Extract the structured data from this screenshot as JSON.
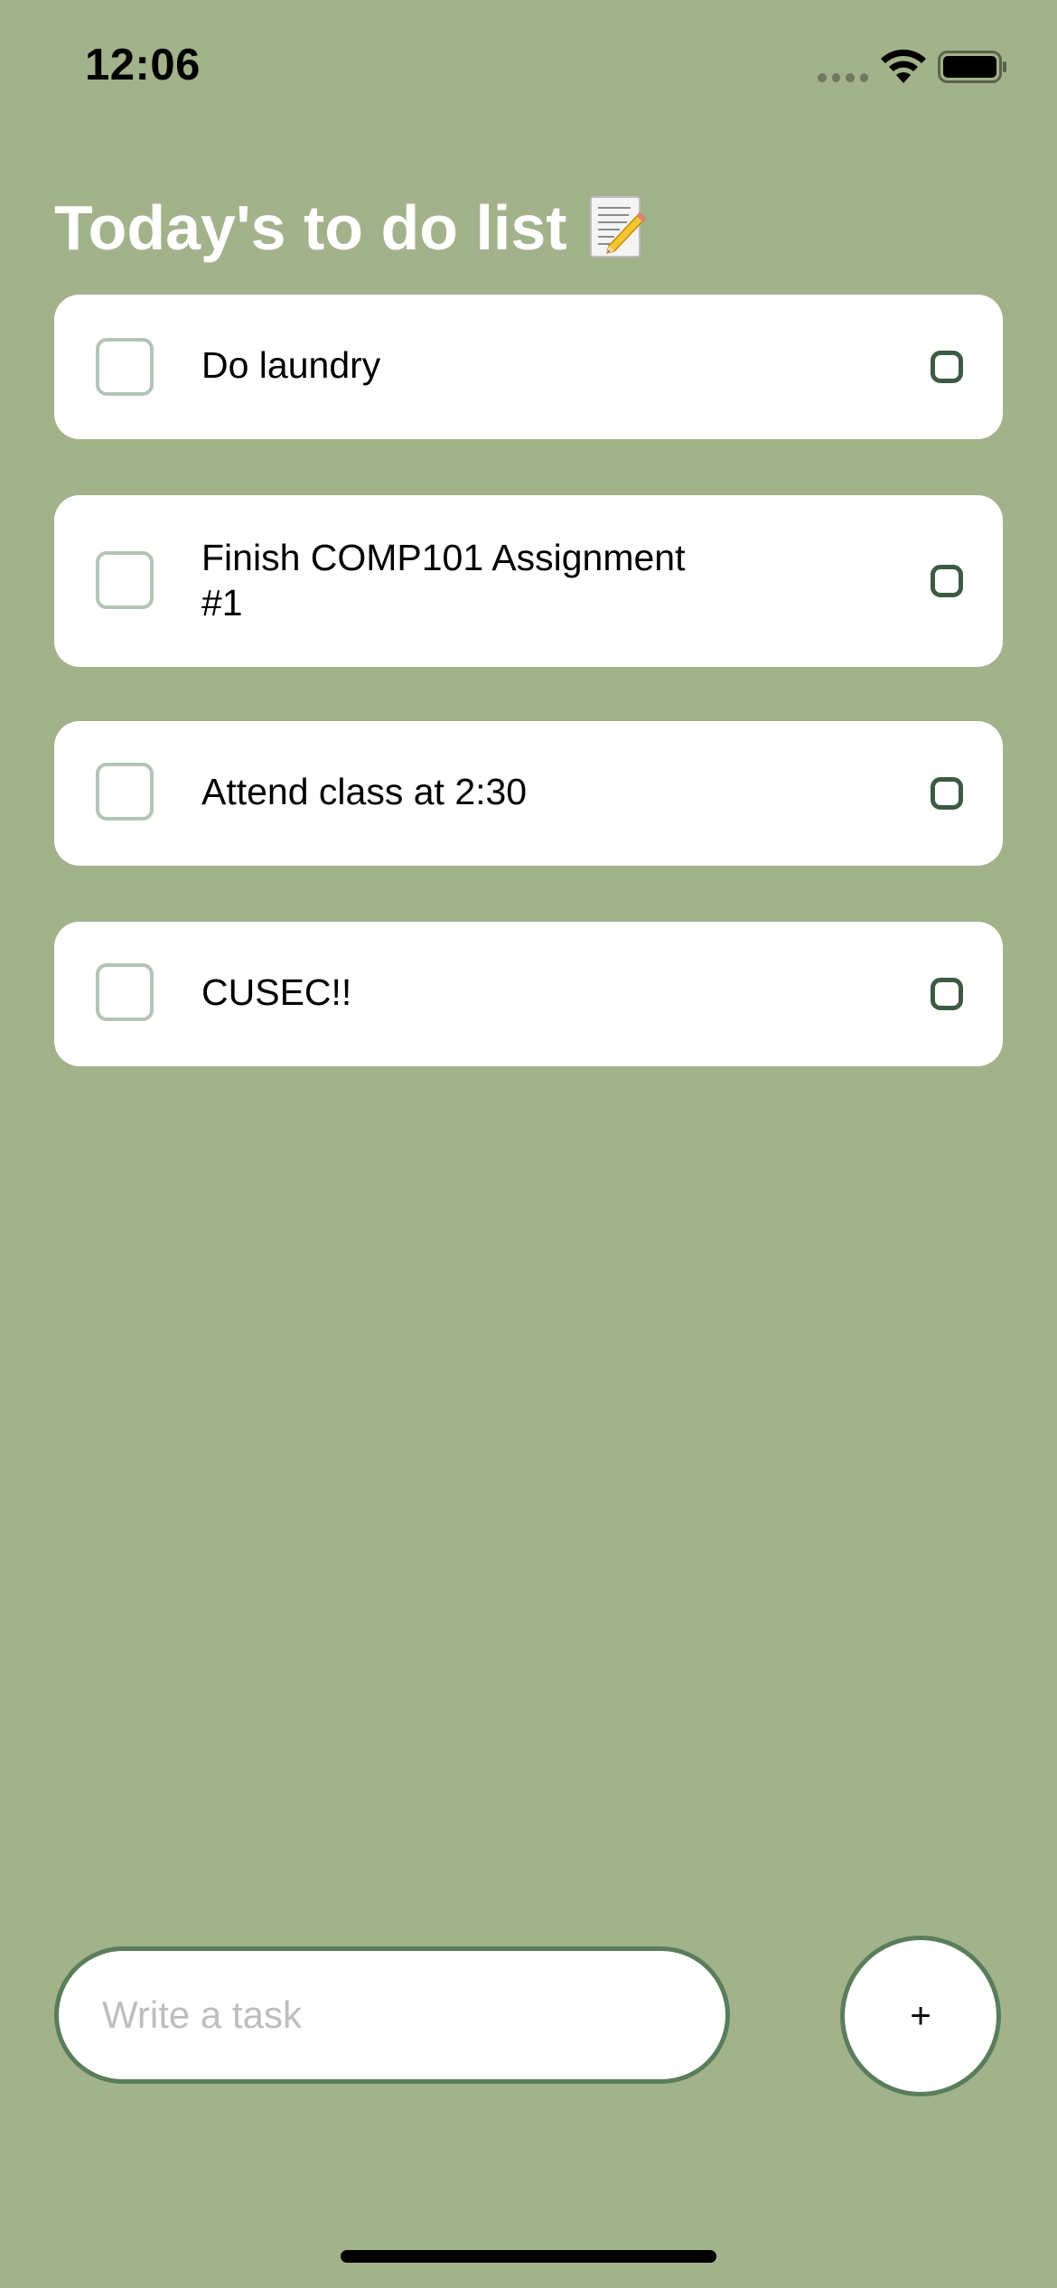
{
  "status_bar": {
    "time": "12:06",
    "icons": [
      "signal-icon",
      "wifi-icon",
      "battery-icon"
    ]
  },
  "header": {
    "title": "Today's to do list",
    "title_icon": "memo-icon"
  },
  "tasks": [
    {
      "text": "Do laundry",
      "completed": false
    },
    {
      "text": "Finish COMP101 Assignment #1",
      "completed": false
    },
    {
      "text": "Attend class at 2:30",
      "completed": false
    },
    {
      "text": "CUSEC!!",
      "completed": false
    }
  ],
  "composer": {
    "input_placeholder": "Write a task",
    "input_value": "",
    "add_label": "+"
  },
  "colors": {
    "background": "#A2B28A",
    "card": "#FFFFFF",
    "checkbox_border": "#B3C4B6",
    "ring": "#3D5A42",
    "input_border": "#5A7D5C",
    "title_text": "#FFFFFF"
  }
}
